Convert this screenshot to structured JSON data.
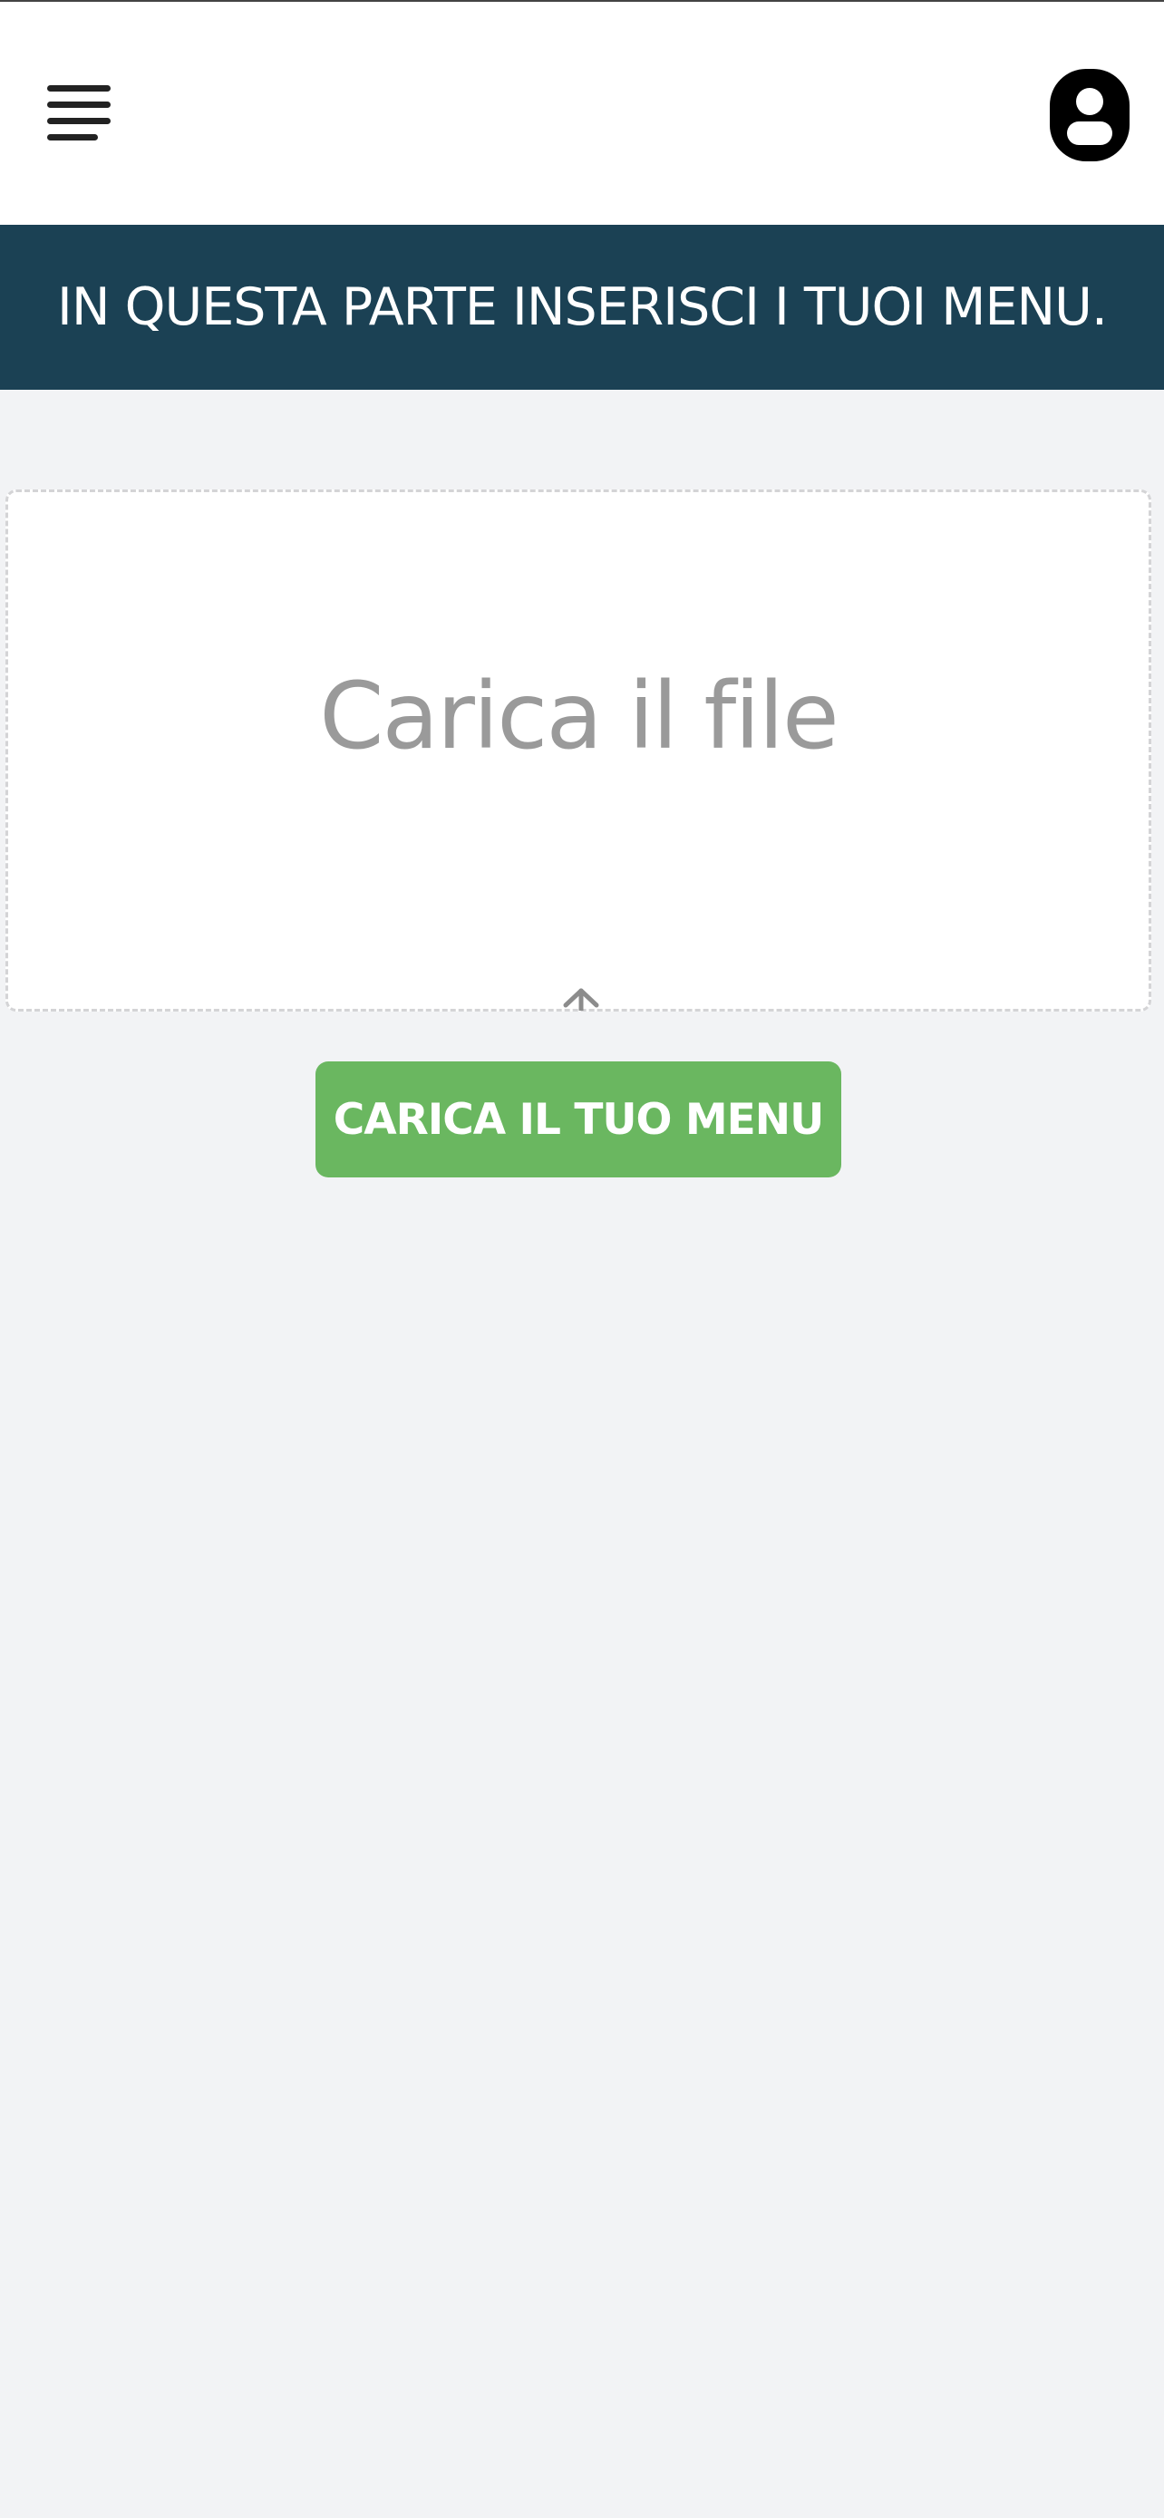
{
  "header": {
    "menu_icon": "hamburger-menu-icon",
    "profile_icon": "user-profile-icon"
  },
  "banner": {
    "text": "IN QUESTA PARTE INSERISCI I TUOI MENU."
  },
  "upload": {
    "dropzone_label": "Carica il file",
    "arrow_icon": "upload-arrow-icon",
    "button_label": "CARICA IL TUO MENU"
  },
  "colors": {
    "banner_bg": "#1b4154",
    "button_bg": "#6ab760",
    "page_bg": "#f2f3f5"
  }
}
